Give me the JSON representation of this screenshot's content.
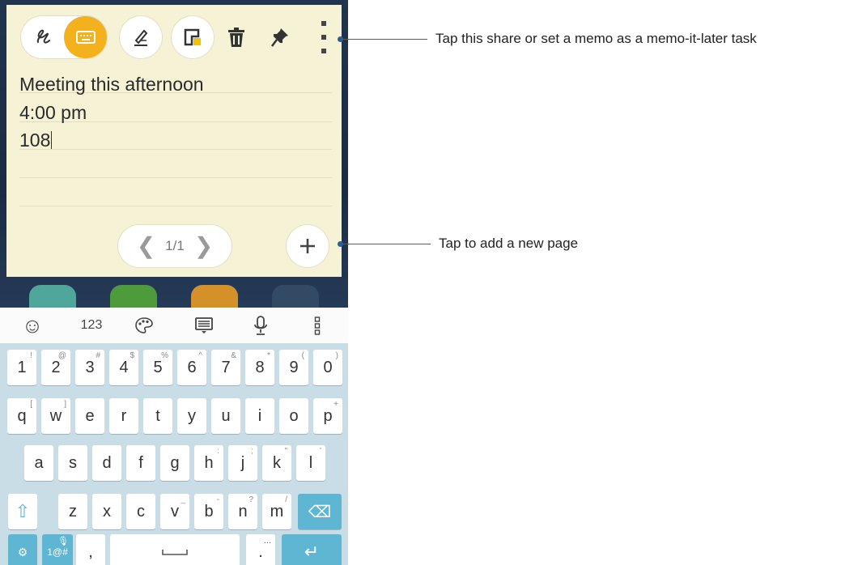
{
  "memo": {
    "toolbar": {
      "handwriting_icon": "handwriting-icon",
      "keyboard_icon": "keyboard-icon",
      "pen_icon": "pen-style-icon",
      "color_icon": "memo-color-icon",
      "delete_icon": "trash-icon",
      "pin_icon": "pin-icon",
      "menu_icon": "more-options-icon",
      "accent_color": "#f2b11d"
    },
    "lines": [
      "Meeting this afternoon",
      "4:00 pm",
      "108"
    ],
    "pager": {
      "prev": "❮",
      "label": "1/1",
      "next": "❯"
    },
    "add_label": "+"
  },
  "keyboard": {
    "bar": {
      "emoji": "☺",
      "numbers": "123",
      "theme": "theme-icon",
      "clipboard": "clipboard-icon",
      "mic": "mic-icon",
      "more": "more-icon"
    },
    "row1": [
      {
        "k": "1",
        "h": "!"
      },
      {
        "k": "2",
        "h": "@"
      },
      {
        "k": "3",
        "h": "#"
      },
      {
        "k": "4",
        "h": "$"
      },
      {
        "k": "5",
        "h": "%"
      },
      {
        "k": "6",
        "h": "^"
      },
      {
        "k": "7",
        "h": "&"
      },
      {
        "k": "8",
        "h": "*"
      },
      {
        "k": "9",
        "h": "("
      },
      {
        "k": "0",
        "h": ")"
      }
    ],
    "row2": [
      {
        "k": "q",
        "h": "["
      },
      {
        "k": "w",
        "h": "]"
      },
      {
        "k": "e",
        "h": ""
      },
      {
        "k": "r",
        "h": ""
      },
      {
        "k": "t",
        "h": ""
      },
      {
        "k": "y",
        "h": ""
      },
      {
        "k": "u",
        "h": ""
      },
      {
        "k": "i",
        "h": ""
      },
      {
        "k": "o",
        "h": ""
      },
      {
        "k": "p",
        "h": "+"
      }
    ],
    "row3": [
      {
        "k": "a",
        "h": ""
      },
      {
        "k": "s",
        "h": ""
      },
      {
        "k": "d",
        "h": ""
      },
      {
        "k": "f",
        "h": ""
      },
      {
        "k": "g",
        "h": ""
      },
      {
        "k": "h",
        "h": ":"
      },
      {
        "k": "j",
        "h": ";"
      },
      {
        "k": "k",
        "h": "\""
      },
      {
        "k": "l",
        "h": "'"
      }
    ],
    "row4": [
      {
        "k": "z",
        "h": ""
      },
      {
        "k": "x",
        "h": ""
      },
      {
        "k": "c",
        "h": ""
      },
      {
        "k": "v",
        "h": "_"
      },
      {
        "k": "b",
        "h": "-"
      },
      {
        "k": "n",
        "h": "?"
      },
      {
        "k": "m",
        "h": "/"
      }
    ],
    "shift": "⇧",
    "backspace": "⌫",
    "settings": "⚙",
    "symbols": "1@#",
    "comma": ",",
    "period": ".",
    "period_hint": "...",
    "enter": "↵",
    "func_color": "#5fb6d3"
  },
  "annotations": {
    "menu": "Tap this share or set a memo as a memo-it-later task",
    "add": "Tap to add a new page"
  }
}
